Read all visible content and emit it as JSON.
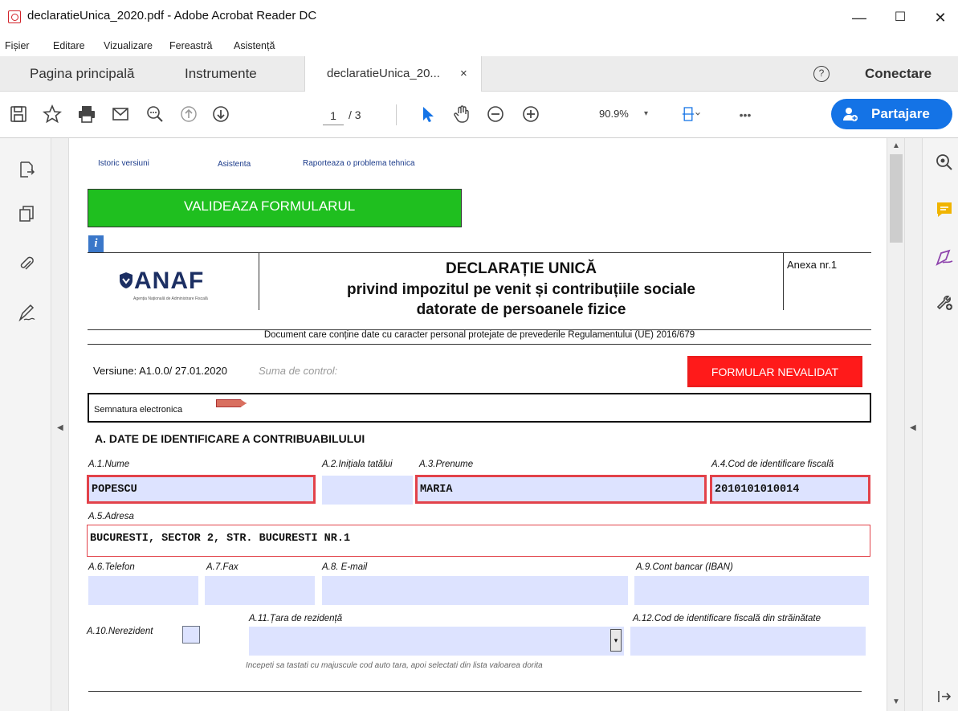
{
  "window": {
    "title": "declaratieUnica_2020.pdf - Adobe Acrobat Reader DC",
    "minimize": "—",
    "maximize": "☐",
    "close": "✕"
  },
  "menu": [
    "Fișier",
    "Editare",
    "Vizualizare",
    "Fereastră",
    "Asistență"
  ],
  "tabs": {
    "home": "Pagina principală",
    "tools": "Instrumente",
    "document": "declaratieUnica_20...",
    "document_close": "×",
    "help": "?",
    "connect": "Conectare"
  },
  "toolbar": {
    "page_current": "1",
    "page_total": "/ 3",
    "zoom": "90.9%",
    "zoom_arrow": "▾",
    "more": "•••",
    "share": "Partajare",
    "accent": "#1473e6"
  },
  "doc": {
    "links": [
      "Istoric versiuni",
      "Asistenta",
      "Raporteaza o problema tehnica"
    ],
    "validate_label": "VALIDEAZA FORMULARUL",
    "info_icon": "i",
    "logo_text": "ANAF",
    "logo_subtext": "Agenția Națională de Administrare Fiscală",
    "title_lines": [
      "DECLARAȚIE UNICĂ",
      "privind impozitul pe venit și contribuțiile sociale",
      "datorate de persoanele fizice"
    ],
    "annex": "Anexa nr.1",
    "privacy_note": "Document care conține date cu caracter personal protejate de prevederile Regulamentului (UE) 2016/679",
    "version": "Versiune: A1.0.0/ 27.01.2020",
    "control_sum": "Suma de control:",
    "status": "FORMULAR NEVALIDAT",
    "signature_label": "Semnatura electronica",
    "section_a": "A. DATE DE IDENTIFICARE A CONTRIBUABILULUI",
    "labels": {
      "a1": "A.1.Nume",
      "a2": "A.2.Inițiala tatălui",
      "a3": "A.3.Prenume",
      "a4": "A.4.Cod de identificare fiscală",
      "a5": "A.5.Adresa",
      "a6": "A.6.Telefon",
      "a7": "A.7.Fax",
      "a8": "A.8. E-mail",
      "a9": "A.9.Cont bancar (IBAN)",
      "a10": "A.10.Nerezident",
      "a11": "A.11.Țara de rezidență",
      "a12": "A.12.Cod de identificare fiscală din străinătate"
    },
    "values": {
      "a1": "POPESCU",
      "a2": "",
      "a3": "MARIA",
      "a4": "2010101010014",
      "a5": "BUCURESTI, SECTOR 2, STR. BUCURESTI NR.1",
      "a6": "",
      "a7": "",
      "a8": "",
      "a9": "",
      "a11": "",
      "a12": ""
    },
    "country_hint": "Incepeti sa tastati cu majuscule cod auto tara, apoi selectati din lista valoarea dorita"
  }
}
